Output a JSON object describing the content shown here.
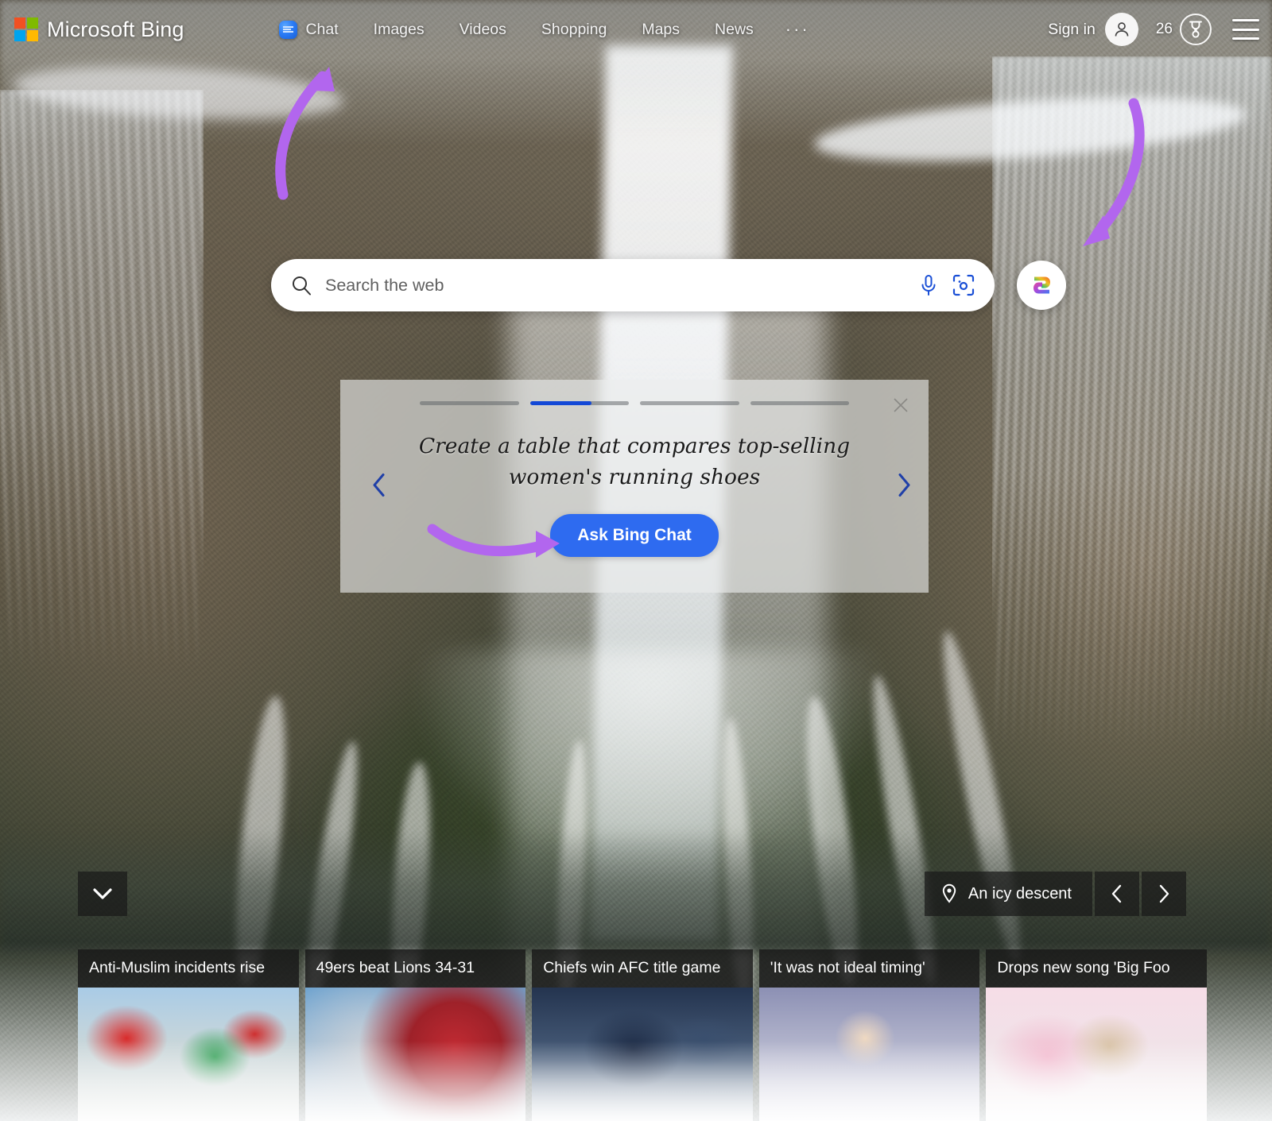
{
  "page": {
    "title": "Microsoft Bing",
    "accent_blue": "#2e6bf0",
    "annotation_purple": "#b266ee"
  },
  "header": {
    "brand": "Microsoft Bing",
    "logo_colors": [
      "#f25022",
      "#7fba00",
      "#00a4ef",
      "#ffb900"
    ],
    "nav": [
      {
        "label": "Chat",
        "icon": "chat-bubble-icon"
      },
      {
        "label": "Images",
        "icon": ""
      },
      {
        "label": "Videos",
        "icon": ""
      },
      {
        "label": "Shopping",
        "icon": ""
      },
      {
        "label": "Maps",
        "icon": ""
      },
      {
        "label": "News",
        "icon": ""
      }
    ],
    "more_label": "···",
    "sign_in": "Sign in",
    "avatar_icon": "person-icon",
    "rewards": {
      "count": "26",
      "icon": "medal-icon"
    },
    "menu_icon": "hamburger-menu-icon"
  },
  "search": {
    "placeholder": "Search the web",
    "value": "",
    "search_icon": "search-icon",
    "mic_icon": "microphone-icon",
    "lens_icon": "visual-search-icon",
    "copilot_icon": "copilot-icon"
  },
  "suggestion_card": {
    "prompt": "Create a table that compares top-selling women's running shoes",
    "cta_label": "Ask Bing Chat",
    "close_icon": "close-icon",
    "prev_icon": "chevron-left-icon",
    "next_icon": "chevron-right-icon",
    "progress": {
      "segments": 4,
      "active_index": 1,
      "active_fill_percent": 62
    }
  },
  "image_info": {
    "expand_icon": "chevron-down-icon",
    "location_icon": "location-pin-icon",
    "caption": "An icy descent",
    "prev_icon": "chevron-left-icon",
    "next_icon": "chevron-right-icon"
  },
  "news": {
    "items": [
      {
        "title": "Anti-Muslim incidents rise",
        "thumb": "th1"
      },
      {
        "title": "49ers beat Lions 34-31",
        "thumb": "th2"
      },
      {
        "title": "Chiefs win AFC title game",
        "thumb": "th3"
      },
      {
        "title": "'It was not ideal timing'",
        "thumb": "th4"
      },
      {
        "title": "Drops new song 'Big Foo",
        "thumb": "th5"
      }
    ]
  },
  "annotations": [
    {
      "name": "arrow-to-chat",
      "points_to": "Chat"
    },
    {
      "name": "arrow-to-copilot",
      "points_to": "Copilot button"
    },
    {
      "name": "arrow-to-ask-bing-chat",
      "points_to": "Ask Bing Chat"
    }
  ]
}
